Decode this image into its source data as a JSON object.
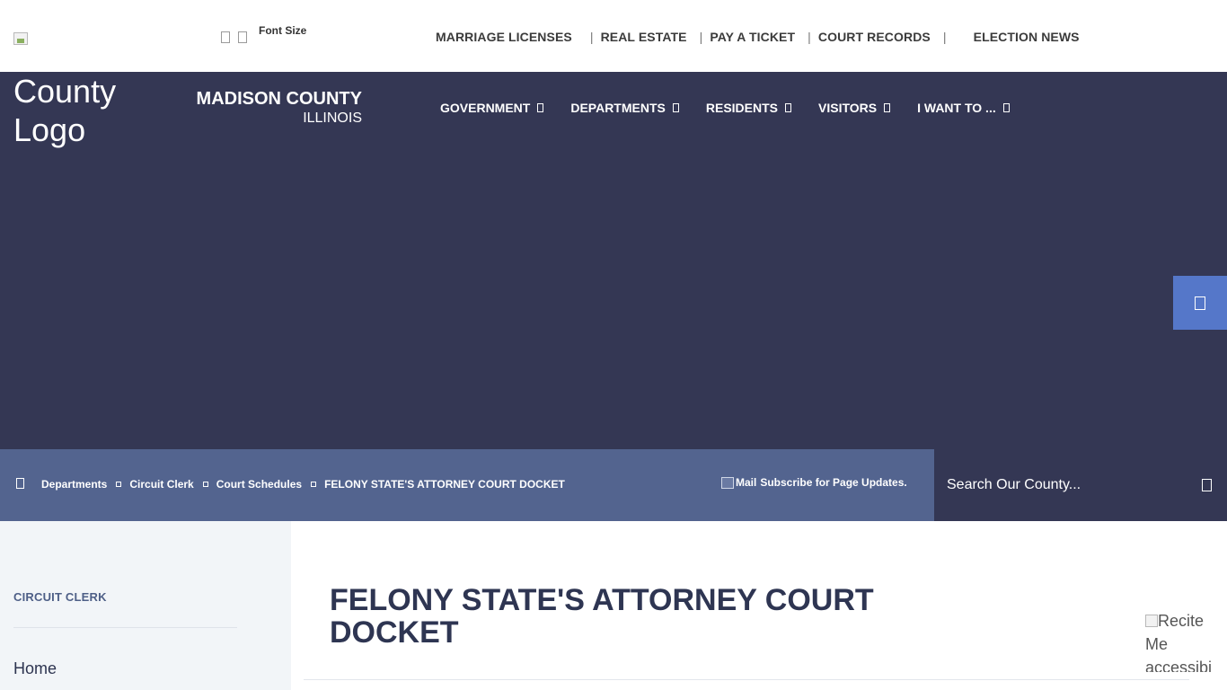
{
  "top_bar": {
    "font_size_label": "Font Size",
    "quick_links": [
      "MARRIAGE LICENSES",
      "REAL ESTATE",
      "PAY A TICKET",
      "COURT RECORDS",
      "ELECTION NEWS"
    ],
    "separator": "|"
  },
  "header": {
    "logo_alt": "County Logo",
    "county_name": "MADISON COUNTY",
    "state": "ILLINOIS",
    "nav": [
      "GOVERNMENT",
      "DEPARTMENTS",
      "RESIDENTS",
      "VISITORS",
      "I WANT TO ..."
    ]
  },
  "breadcrumb": {
    "items": [
      "Departments",
      "Circuit Clerk",
      "Court Schedules",
      "FELONY STATE'S ATTORNEY COURT DOCKET"
    ],
    "subscribe_alt": "Mail",
    "subscribe_text": "Subscribe for Page Updates."
  },
  "search": {
    "placeholder": "Search Our County..."
  },
  "sidebar": {
    "title": "CIRCUIT CLERK",
    "items": [
      "Home"
    ]
  },
  "main": {
    "title": "FELONY STATE'S ATTORNEY COURT DOCKET",
    "recite_alt": "Recite Me accessibility"
  },
  "colors": {
    "header_bg": "#343754",
    "breadcrumb_bg": "#53648f",
    "accent_tab": "#5577c9",
    "sidebar_bg": "#f2f5f8",
    "title_text": "#2e3552"
  },
  "icons": {
    "font_decrease": "font-decrease-icon",
    "font_increase": "font-increase-icon",
    "home": "home-icon",
    "search": "search-icon",
    "side_tab": "accessibility-tab-icon"
  }
}
